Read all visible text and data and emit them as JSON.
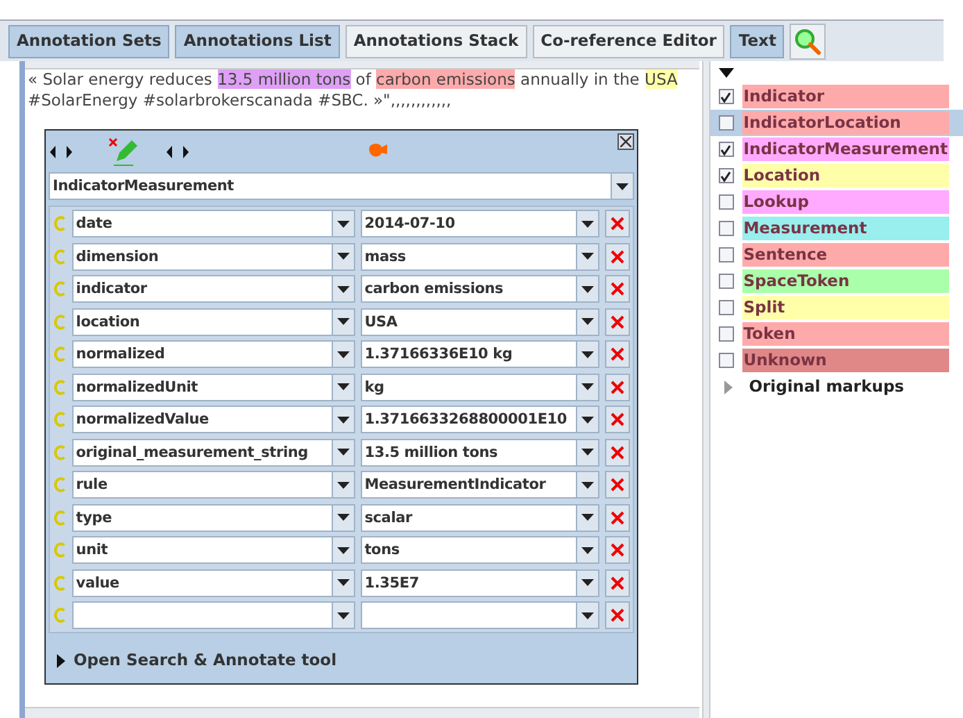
{
  "toolbar": [
    {
      "label": "Annotation Sets",
      "selected": true
    },
    {
      "label": "Annotations List",
      "selected": true
    },
    {
      "label": "Annotations Stack",
      "selected": false
    },
    {
      "label": "Co-reference Editor",
      "selected": false
    },
    {
      "label": "Text",
      "selected": true
    }
  ],
  "document": {
    "segments": [
      {
        "text": "« Solar energy reduces "
      },
      {
        "text": "13.5 million tons",
        "color": "#dda0f4"
      },
      {
        "text": " of "
      },
      {
        "text": "carbon emissions",
        "color": "#ffaaaa"
      },
      {
        "text": " annually in the "
      },
      {
        "text": "USA",
        "color": "#ffffaa"
      },
      {
        "text": " #SolarEnergy #solarbrokerscanada #SBC. »\",,,,,,,,,,,,"
      }
    ]
  },
  "editor": {
    "type": "IndicatorMeasurement",
    "features": [
      {
        "name": "date",
        "value": "2014-07-10"
      },
      {
        "name": "dimension",
        "value": "mass"
      },
      {
        "name": "indicator",
        "value": "carbon emissions"
      },
      {
        "name": "location",
        "value": "USA"
      },
      {
        "name": "normalized",
        "value": "1.37166336E10 kg"
      },
      {
        "name": "normalizedUnit",
        "value": "kg"
      },
      {
        "name": "normalizedValue",
        "value": "1.3716633268800001E10"
      },
      {
        "name": "original_measurement_string",
        "value": "13.5 million tons"
      },
      {
        "name": "rule",
        "value": "MeasurementIndicator"
      },
      {
        "name": "type",
        "value": "scalar"
      },
      {
        "name": "unit",
        "value": "tons"
      },
      {
        "name": "value",
        "value": "1.35E7"
      },
      {
        "kind": "blank"
      }
    ],
    "search_tool": {
      "label": "Open Search & Annotate tool",
      "expanded": false
    }
  },
  "annotation_types": [
    {
      "label": "Indicator",
      "checked": true,
      "selected": false,
      "color": "#ffaaaa"
    },
    {
      "label": "IndicatorLocation",
      "checked": false,
      "selected": true,
      "color": "#ffaaaa"
    },
    {
      "label": "IndicatorMeasurement",
      "checked": true,
      "selected": false,
      "color": "#ffaaff"
    },
    {
      "label": "Location",
      "checked": true,
      "selected": false,
      "color": "#ffffaa"
    },
    {
      "label": "Lookup",
      "checked": false,
      "selected": false,
      "color": "#ffaaff"
    },
    {
      "label": "Measurement",
      "checked": false,
      "selected": false,
      "color": "#99eeee"
    },
    {
      "label": "Sentence",
      "checked": false,
      "selected": false,
      "color": "#ffaaaa"
    },
    {
      "label": "SpaceToken",
      "checked": false,
      "selected": false,
      "color": "#aaffaa"
    },
    {
      "label": "Split",
      "checked": false,
      "selected": false,
      "color": "#ffffaa"
    },
    {
      "label": "Token",
      "checked": false,
      "selected": false,
      "color": "#ffaaaa"
    },
    {
      "label": "Unknown",
      "checked": false,
      "selected": false,
      "color": "#e08888"
    }
  ],
  "markups_set": {
    "label": "Original markups",
    "expanded": false
  }
}
